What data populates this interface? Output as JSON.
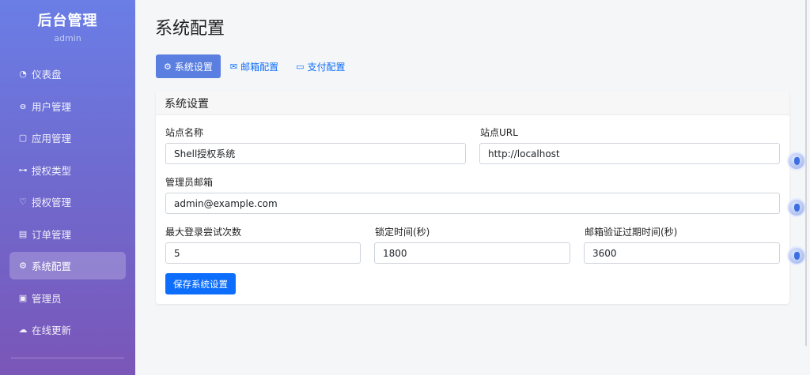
{
  "sidebar": {
    "title": "后台管理",
    "subtitle": "admin",
    "items": [
      {
        "label": "仪表盘",
        "icon": "dashboard-icon",
        "glyph": "◔"
      },
      {
        "label": "用户管理",
        "icon": "users-icon",
        "glyph": "ꙫ"
      },
      {
        "label": "应用管理",
        "icon": "app-square-icon",
        "glyph": "▢"
      },
      {
        "label": "授权类型",
        "icon": "key-icon",
        "glyph": "⊶"
      },
      {
        "label": "授权管理",
        "icon": "shield-icon",
        "glyph": "♡"
      },
      {
        "label": "订单管理",
        "icon": "receipt-icon",
        "glyph": "▤"
      },
      {
        "label": "系统配置",
        "icon": "gear-icon",
        "glyph": "⚙"
      },
      {
        "label": "管理员",
        "icon": "person-badge-icon",
        "glyph": "▣"
      },
      {
        "label": "在线更新",
        "icon": "cloud-upload-icon",
        "glyph": "☁"
      }
    ],
    "active_index": 6
  },
  "page": {
    "title": "系统配置"
  },
  "tabs": [
    {
      "label": "系统设置",
      "icon": "gear-icon",
      "glyph": "⚙",
      "active": true
    },
    {
      "label": "邮箱配置",
      "icon": "envelope-icon",
      "glyph": "✉",
      "active": false
    },
    {
      "label": "支付配置",
      "icon": "credit-card-icon",
      "glyph": "▭",
      "active": false
    }
  ],
  "card": {
    "title": "系统设置",
    "fields": {
      "site_name": {
        "label": "站点名称",
        "value": "Shell授权系统"
      },
      "site_url": {
        "label": "站点URL",
        "value": "http://localhost"
      },
      "admin_email": {
        "label": "管理员邮箱",
        "value": "admin@example.com"
      },
      "max_login_attempts": {
        "label": "最大登录尝试次数",
        "value": "5"
      },
      "lockout_time": {
        "label": "锁定时间(秒)",
        "value": "1800"
      },
      "email_verify_expire": {
        "label": "邮箱验证过期时间(秒)",
        "value": "3600"
      }
    },
    "save_label": "保存系统设置"
  }
}
